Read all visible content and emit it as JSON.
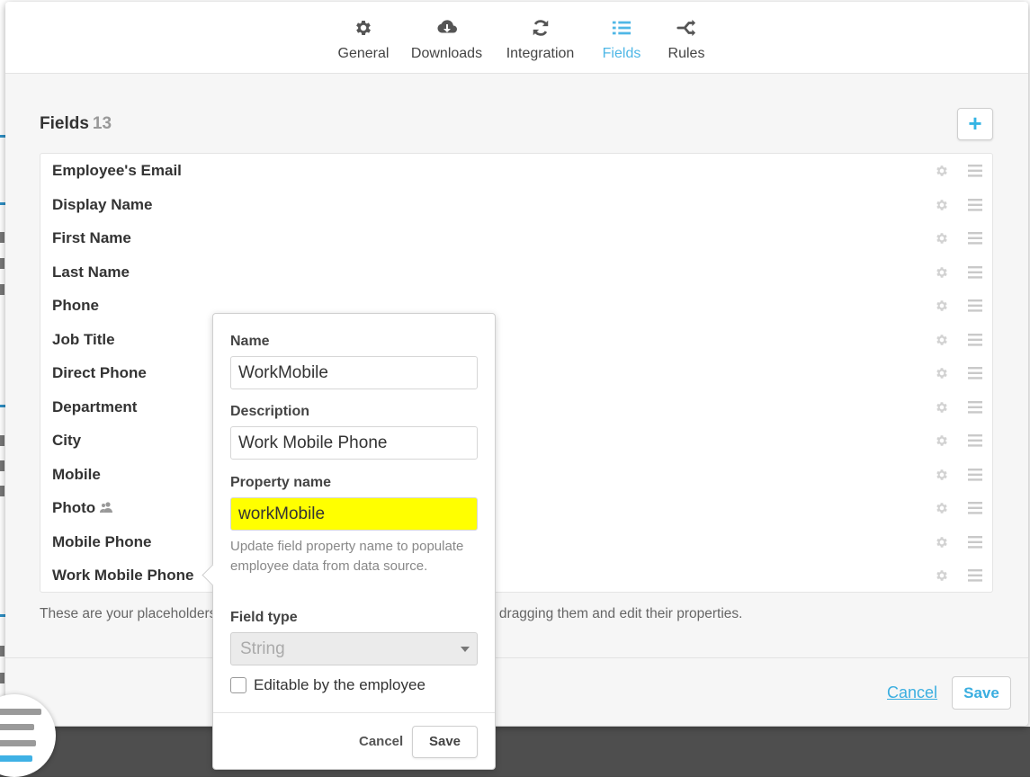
{
  "tabs": [
    {
      "label": "General",
      "icon": "gear-icon",
      "active": false
    },
    {
      "label": "Downloads",
      "icon": "cloud-download-icon",
      "active": false
    },
    {
      "label": "Integration",
      "icon": "sync-icon",
      "active": false
    },
    {
      "label": "Fields",
      "icon": "list-icon",
      "active": true
    },
    {
      "label": "Rules",
      "icon": "branch-icon",
      "active": false
    }
  ],
  "fields_section": {
    "title": "Fields",
    "count": "13",
    "add_button_label": "+"
  },
  "fields": [
    {
      "name": "Employee's Email"
    },
    {
      "name": "Display Name"
    },
    {
      "name": "First Name"
    },
    {
      "name": "Last Name"
    },
    {
      "name": "Phone"
    },
    {
      "name": "Job Title"
    },
    {
      "name": "Direct Phone"
    },
    {
      "name": "Department"
    },
    {
      "name": "City"
    },
    {
      "name": "Mobile"
    },
    {
      "name": "Photo",
      "badge_icon": "users-icon"
    },
    {
      "name": "Mobile Phone"
    },
    {
      "name": "Work Mobile Phone"
    }
  ],
  "helper_text": "These are your placeholders to use in your templates. Rearrange them by dragging them and edit their properties.",
  "footer": {
    "cancel_label": "Cancel",
    "save_label": "Save"
  },
  "popover": {
    "name_label": "Name",
    "name_value": "WorkMobile",
    "description_label": "Description",
    "description_value": "Work Mobile Phone",
    "property_label": "Property name",
    "property_value": "workMobile",
    "property_hint": "Update field property name to populate employee data from data source.",
    "field_type_label": "Field type",
    "field_type_value": "String",
    "editable_label": "Editable by the employee",
    "editable_checked": false,
    "cancel_label": "Cancel",
    "save_label": "Save"
  },
  "colors": {
    "accent": "#4fb7e6",
    "highlight": "#ffff00",
    "launcher_gray": "#9a9a9a",
    "launcher_blue": "#3fb1e5"
  }
}
